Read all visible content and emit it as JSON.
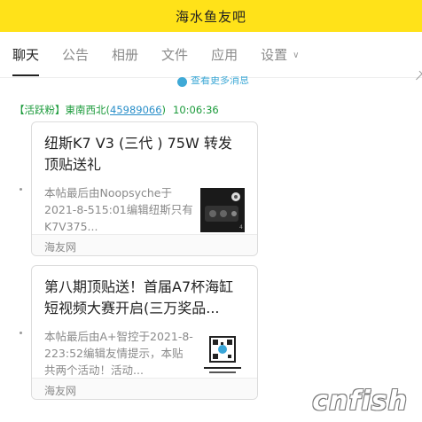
{
  "window": {
    "title": "海水鱼友吧"
  },
  "tabs": [
    {
      "label": "聊天",
      "active": true
    },
    {
      "label": "公告"
    },
    {
      "label": "相册"
    },
    {
      "label": "文件"
    },
    {
      "label": "应用"
    },
    {
      "label": "设置"
    }
  ],
  "more_messages": "查看更多消息",
  "message": {
    "tag": "【活跃粉】",
    "name": "東南西北",
    "uid": "45989066",
    "time": "10:06:36",
    "cards": [
      {
        "title": "纽斯K7 V3 (三代 ) 75W 转发顶贴送礼",
        "summary": "本帖最后由Noopsyche于2021-8-515:01编辑纽斯只有K7V375...",
        "source": "海友网",
        "thumb_icon": "aquarium-light-thumbnail"
      },
      {
        "title": "第八期顶贴送！首届A7杯海缸短视频大赛开启(三万奖品...",
        "summary": "本帖最后由A+智控于2021-8-223:52编辑友情提示，本贴共两个活动！活动...",
        "source": "海友网",
        "thumb_icon": "qr-code-thumbnail"
      }
    ]
  },
  "watermark": "cnfish"
}
